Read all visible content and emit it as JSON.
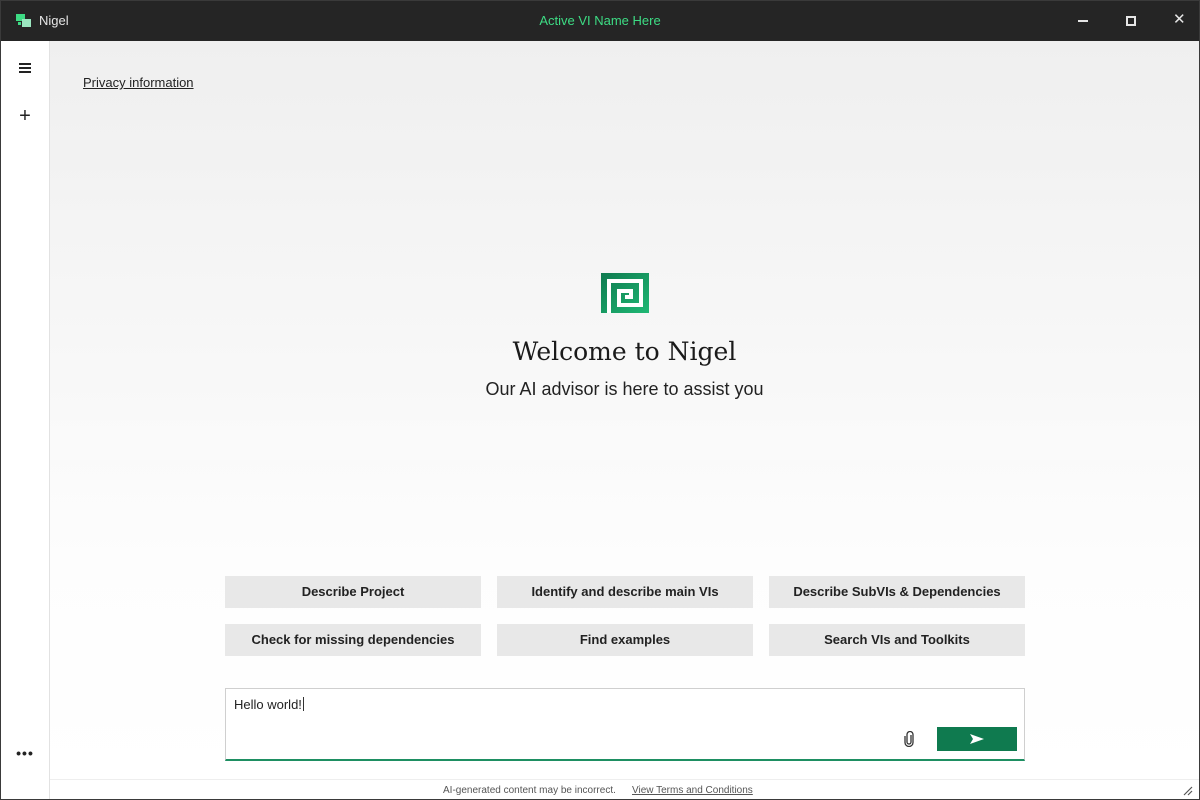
{
  "app": {
    "name": "Nigel",
    "active_vi": "Active VI Name Here",
    "brand_color": "#0f7a4f",
    "accent_color": "#3ddc84"
  },
  "titlebar": {
    "icons": [
      "app-logo-icon",
      "minimize-icon",
      "maximize-icon",
      "close-icon"
    ],
    "close_glyph": "✕"
  },
  "sidebar": {
    "icons": [
      "menu-icon",
      "plus-icon",
      "more-icon"
    ],
    "plus_glyph": "+",
    "more_glyph": "•••"
  },
  "main": {
    "privacy_link": "Privacy information",
    "welcome_title": "Welcome to Nigel",
    "welcome_subtitle": "Our AI advisor is here to assist you",
    "suggestions": [
      "Describe Project",
      "Identify and describe main VIs",
      "Describe SubVIs & Dependencies",
      "Check for missing dependencies",
      "Find examples",
      "Search VIs and Toolkits"
    ]
  },
  "chat": {
    "input_value": "Hello world!",
    "icons": [
      "paperclip-icon",
      "send-icon"
    ]
  },
  "footer": {
    "disclaimer": "AI-generated content may be incorrect.",
    "terms_link": "View Terms and Conditions"
  }
}
